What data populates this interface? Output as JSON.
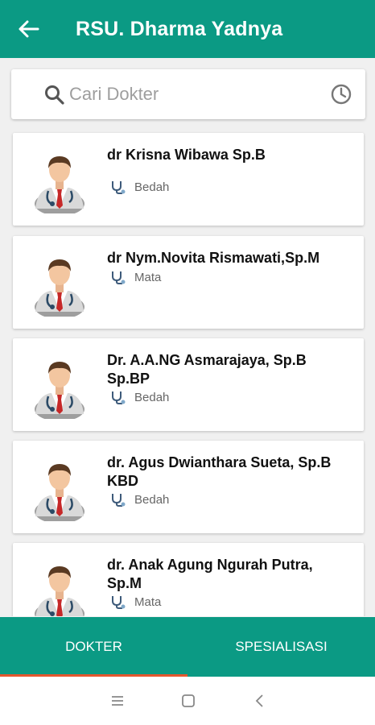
{
  "header": {
    "title": "RSU. Dharma Yadnya"
  },
  "search": {
    "placeholder": "Cari Dokter",
    "value": ""
  },
  "doctors": [
    {
      "name": "dr Krisna Wibawa Sp.B",
      "specialty": "Bedah"
    },
    {
      "name": "dr Nym.Novita Rismawati,Sp.M",
      "specialty": "Mata"
    },
    {
      "name": "Dr. A.A.NG Asmarajaya, Sp.B Sp.BP",
      "specialty": "Bedah"
    },
    {
      "name": "dr. Agus Dwianthara Sueta, Sp.B KBD",
      "specialty": "Bedah"
    },
    {
      "name": "dr. Anak Agung Ngurah Putra, Sp.M",
      "specialty": "Mata"
    }
  ],
  "tabs": [
    {
      "label": "DOKTER",
      "active": true
    },
    {
      "label": "SPESIALISASI",
      "active": false
    }
  ],
  "colors": {
    "primary": "#0b9a84",
    "indicator": "#e4572e"
  },
  "icons": [
    "back-arrow-icon",
    "search-icon",
    "history-clock-icon",
    "doctor-avatar-icon",
    "stethoscope-icon",
    "recents-icon",
    "home-icon",
    "back-icon"
  ]
}
